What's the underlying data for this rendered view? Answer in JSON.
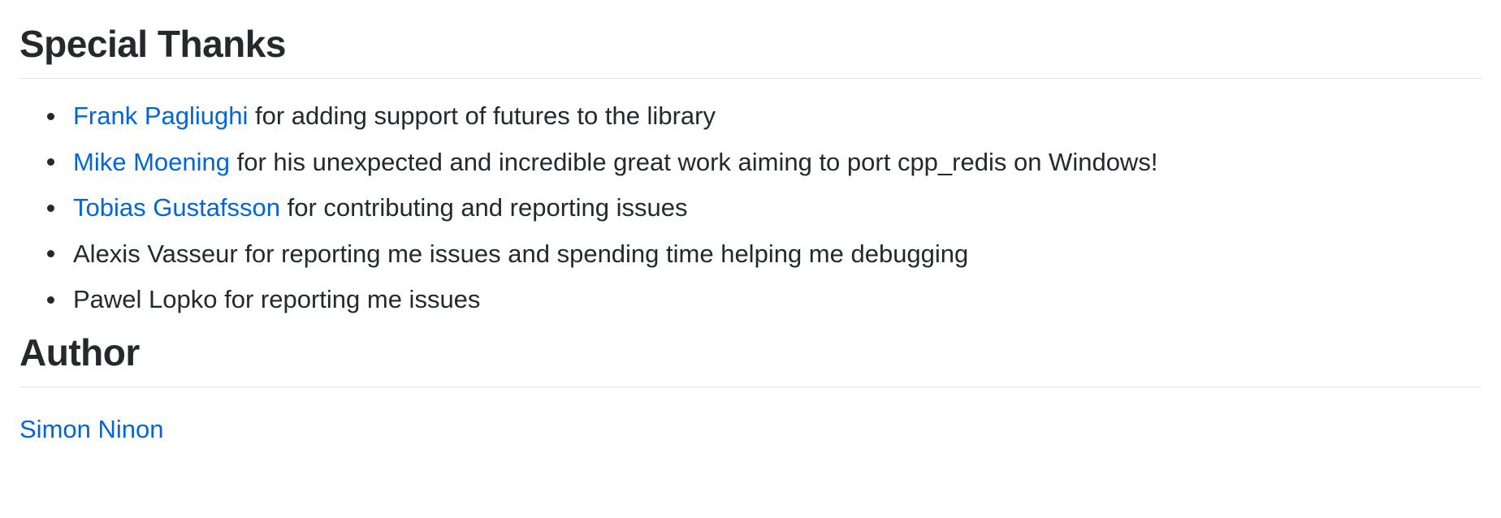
{
  "special_thanks": {
    "heading": "Special Thanks",
    "items": [
      {
        "link": "Frank Pagliughi",
        "text": " for adding support of futures to the library"
      },
      {
        "link": "Mike Moening",
        "text": " for his unexpected and incredible great work aiming to port cpp_redis on Windows!"
      },
      {
        "link": "Tobias Gustafsson",
        "text": " for contributing and reporting issues"
      },
      {
        "link": null,
        "text": "Alexis Vasseur for reporting me issues and spending time helping me debugging"
      },
      {
        "link": null,
        "text": "Pawel Lopko for reporting me issues"
      }
    ]
  },
  "author": {
    "heading": "Author",
    "name": "Simon Ninon"
  },
  "colors": {
    "text": "#24292e",
    "link": "#0366d6",
    "divider": "#e1e4e8"
  }
}
